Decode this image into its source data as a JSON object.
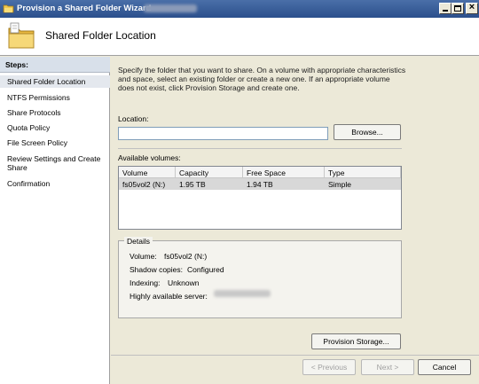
{
  "window": {
    "title": "Provision a Shared Folder Wizard",
    "title_icon": "folder-share-icon",
    "buttons": {
      "minimize": "minimize-icon",
      "maximize": "maximize-icon",
      "close": "close-icon",
      "close_glyph": "×"
    }
  },
  "header": {
    "title": "Shared Folder Location",
    "icon": "folder-icon"
  },
  "sidebar": {
    "heading": "Steps:",
    "items": [
      {
        "label": "Shared Folder Location",
        "selected": true
      },
      {
        "label": "NTFS Permissions",
        "selected": false
      },
      {
        "label": "Share Protocols",
        "selected": false
      },
      {
        "label": "Quota Policy",
        "selected": false
      },
      {
        "label": "File Screen Policy",
        "selected": false
      },
      {
        "label": "Review Settings and Create Share",
        "selected": false
      },
      {
        "label": "Confirmation",
        "selected": false
      }
    ]
  },
  "main": {
    "description": "Specify the folder that you want to share. On a volume with appropriate characteristics and space, select an existing folder or create a new one. If an appropriate volume does not exist, click Provision Storage and create one.",
    "location": {
      "label": "Location:",
      "value": "",
      "placeholder": ""
    },
    "browse_label": "Browse...",
    "volumes": {
      "label": "Available volumes:",
      "columns": [
        "Volume",
        "Capacity",
        "Free Space",
        "Type"
      ],
      "rows": [
        {
          "volume": "fs05vol2 (N:)",
          "capacity": "1.95 TB",
          "free": "1.94 TB",
          "type": "Simple"
        }
      ]
    },
    "details": {
      "heading": "Details",
      "volume_label": "Volume:",
      "volume_value": "fs05vol2 (N:)",
      "shadow_label": "Shadow copies:",
      "shadow_value": "Configured",
      "indexing_label": "Indexing:",
      "indexing_value": "Unknown",
      "ha_label": "Highly available server:"
    },
    "provision_label": "Provision Storage..."
  },
  "footer": {
    "previous": "< Previous",
    "next": "Next >",
    "cancel": "Cancel"
  }
}
